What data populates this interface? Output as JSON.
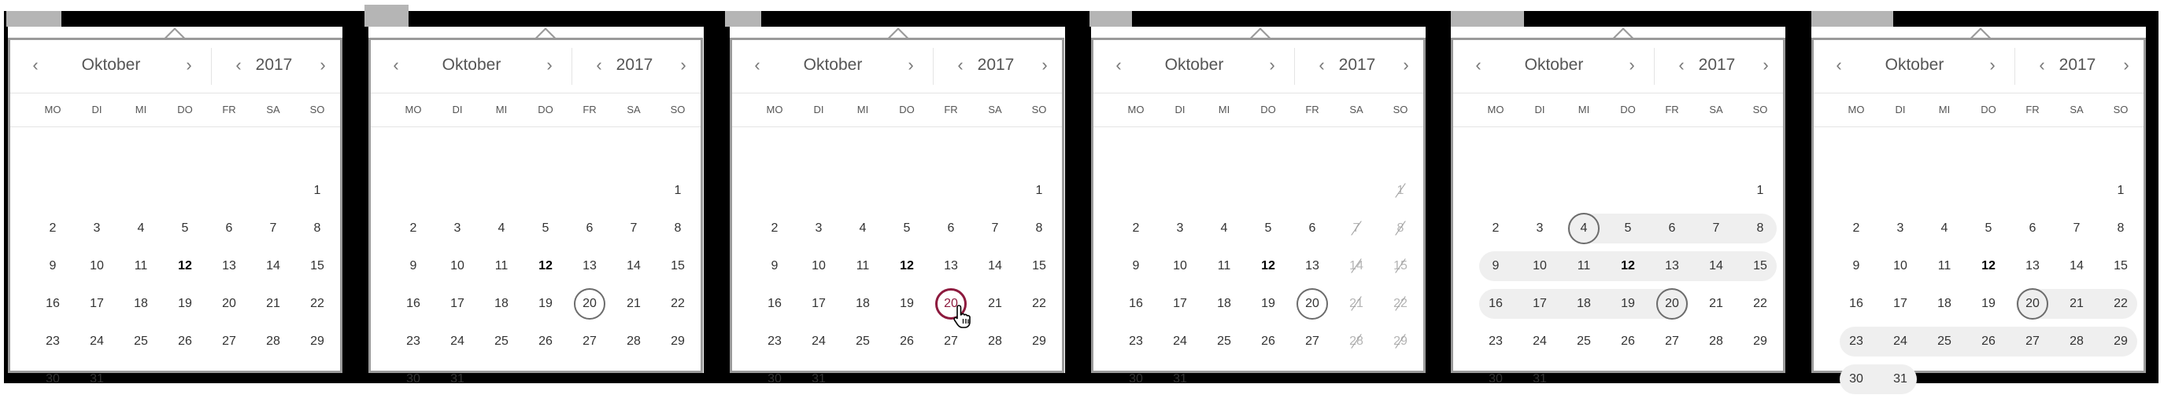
{
  "weekdays": [
    "MO",
    "DI",
    "MI",
    "DO",
    "FR",
    "SA",
    "SO"
  ],
  "colors": {
    "accent": "#8d1a3e",
    "selected_ring": "#6c6c6c",
    "range_fill": "#efefef",
    "frame": "#9a9a9a"
  },
  "icons": {
    "prev": "chevron-left-icon",
    "next": "chevron-right-icon",
    "cursor": "hand-pointer-icon"
  },
  "calendars": [
    {
      "month": "Oktober",
      "year": "2017",
      "today": 12,
      "selected": [],
      "active": null,
      "disabled": [],
      "range": null
    },
    {
      "month": "Oktober",
      "year": "2017",
      "today": 12,
      "selected": [
        20
      ],
      "active": null,
      "disabled": [],
      "range": null
    },
    {
      "month": "Oktober",
      "year": "2017",
      "today": 12,
      "selected": [],
      "active": 20,
      "disabled": [],
      "range": null,
      "cursor": true
    },
    {
      "month": "Oktober",
      "year": "2017",
      "today": 12,
      "selected": [
        20
      ],
      "active": null,
      "disabled": [
        1,
        7,
        8,
        14,
        15,
        21,
        22,
        28,
        29
      ],
      "range": null
    },
    {
      "month": "Oktober",
      "year": "2017",
      "today": 12,
      "selected": [
        4,
        20
      ],
      "active": null,
      "disabled": [],
      "range": [
        4,
        20
      ]
    },
    {
      "month": "Oktober",
      "year": "2017",
      "today": 12,
      "selected": [
        20
      ],
      "active": null,
      "disabled": [],
      "range": [
        20,
        31
      ]
    }
  ]
}
